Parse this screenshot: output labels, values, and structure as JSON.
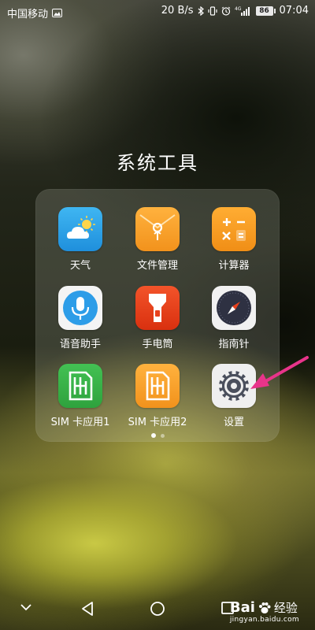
{
  "status_bar": {
    "carrier": "中国移动",
    "network_speed": "20 B/s",
    "network_type": "4G",
    "battery": "86",
    "time": "07:04"
  },
  "folder": {
    "title": "系统工具",
    "page_count": 2,
    "current_page": 1,
    "apps": [
      {
        "label": "天气",
        "icon": "weather-icon",
        "color": "#33a6e8"
      },
      {
        "label": "文件管理",
        "icon": "folder-icon",
        "color": "#f7a12d"
      },
      {
        "label": "计算器",
        "icon": "calculator-icon",
        "color": "#f49b26"
      },
      {
        "label": "语音助手",
        "icon": "microphone-icon",
        "color": "#2d9de8"
      },
      {
        "label": "手电筒",
        "icon": "flashlight-icon",
        "color": "#e8411d"
      },
      {
        "label": "指南针",
        "icon": "compass-icon",
        "color": "#3b3f52"
      },
      {
        "label": "SIM 卡应用1",
        "icon": "sim-card-icon",
        "color": "#39b54a"
      },
      {
        "label": "SIM 卡应用2",
        "icon": "sim-card-icon",
        "color": "#f7a12d"
      },
      {
        "label": "设置",
        "icon": "gear-icon",
        "color": "#4a4f5c"
      }
    ]
  },
  "annotation": {
    "arrow_color": "#e8348a"
  },
  "nav_bar": {
    "items": [
      "chevron-down-icon",
      "back-icon",
      "home-icon",
      "recents-icon"
    ]
  },
  "watermark": {
    "brand": "Bai",
    "brand_suffix": "经验",
    "url": "jingyan.baidu.com"
  }
}
